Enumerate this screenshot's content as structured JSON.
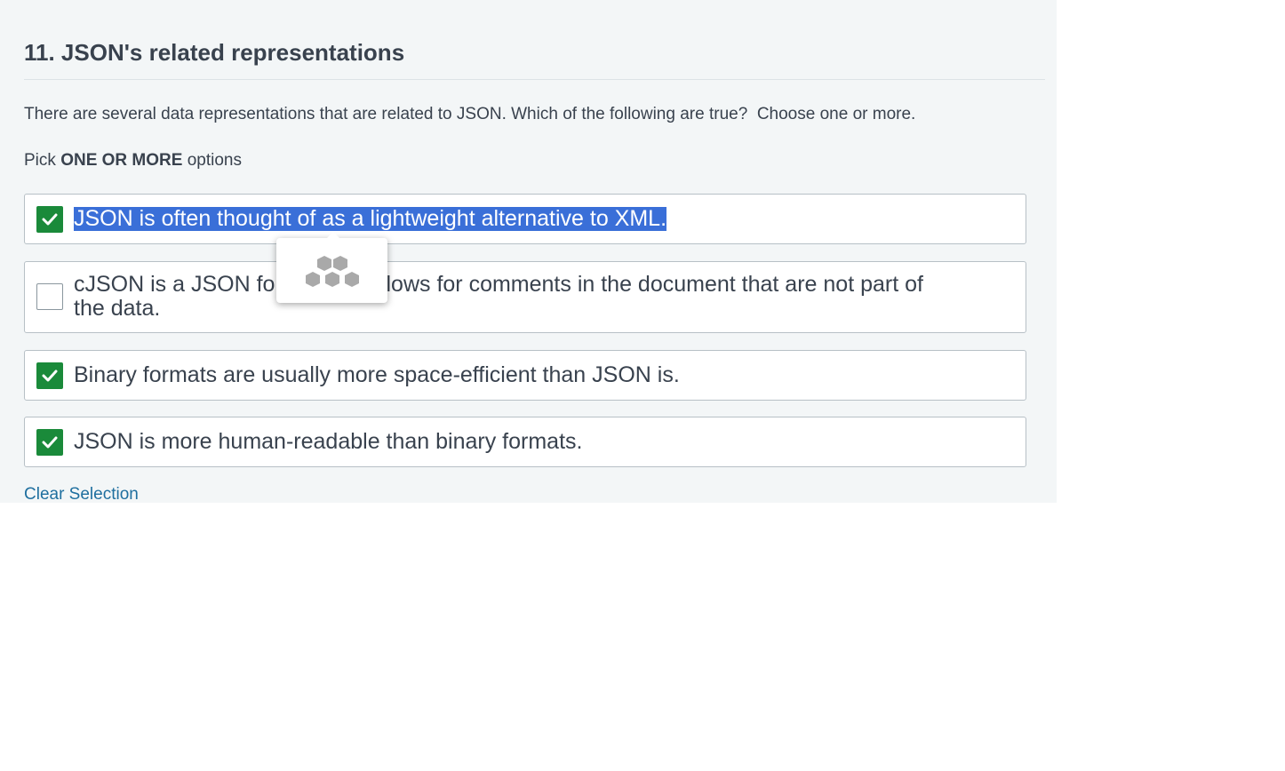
{
  "question": {
    "title": "11. JSON's related representations",
    "prompt": "There are several data representations that are related to JSON. Which of the following are true?  Choose one or more.",
    "pick_prefix": "Pick ",
    "pick_emphasis": "ONE OR MORE",
    "pick_suffix": " options"
  },
  "options": [
    {
      "label": "JSON is often thought of as a lightweight alternative to XML.",
      "checked": true,
      "text_selected": true
    },
    {
      "label": "cJSON is a JSON format that allows for comments in the document that are not part of the data.",
      "checked": false
    },
    {
      "label": "Binary formats are usually more space-efficient than JSON is.",
      "checked": true
    },
    {
      "label": "JSON is more human-readable than binary formats.",
      "checked": true
    }
  ],
  "clear_selection_label": "Clear Selection",
  "tooltip": {
    "icon": "hexagon-cluster-icon"
  },
  "colors": {
    "checked": "#1a8a3a",
    "selection_highlight": "#3a6fd8",
    "link": "#1f6f9f",
    "panel_background": "#f3f6f7"
  }
}
